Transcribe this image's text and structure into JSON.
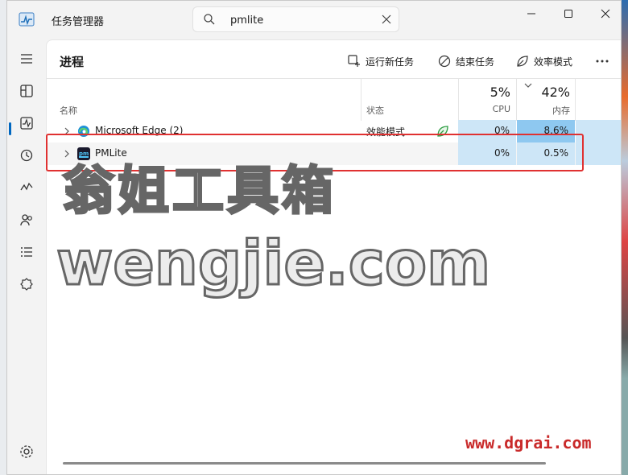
{
  "window": {
    "title": "任务管理器"
  },
  "search": {
    "value": "pmlite"
  },
  "page": {
    "title": "进程"
  },
  "toolbar": {
    "run_new_task": "运行新任务",
    "end_task": "结束任务",
    "efficiency_mode": "效率模式"
  },
  "table": {
    "headers": {
      "name": "名称",
      "status": "状态",
      "cpu_pct": "5%",
      "cpu": "CPU",
      "mem_pct": "42%",
      "mem": "内存"
    },
    "rows": [
      {
        "name": "Microsoft Edge (2)",
        "status": "效能模式",
        "cpu": "0%",
        "memory": "8.6%"
      },
      {
        "name": "PMLite",
        "status": "",
        "cpu": "0%",
        "memory": "0.5%"
      }
    ]
  },
  "watermark": {
    "line1": "翁姐工具箱",
    "line2": "wengjie.com",
    "site": "www.dgrai.com"
  },
  "icons": {
    "app": "task-manager-icon",
    "search": "search-icon",
    "clear": "close-icon",
    "nav": [
      "hamburger-icon",
      "processes-icon",
      "performance-icon",
      "history-icon",
      "startup-icon",
      "users-icon",
      "details-icon",
      "services-icon",
      "settings-icon"
    ]
  },
  "colors": {
    "accent": "#0067c0",
    "cpu_cell": "#cde6f7",
    "mem_cell_high": "#8ec8f0",
    "highlight": "#e03131"
  }
}
